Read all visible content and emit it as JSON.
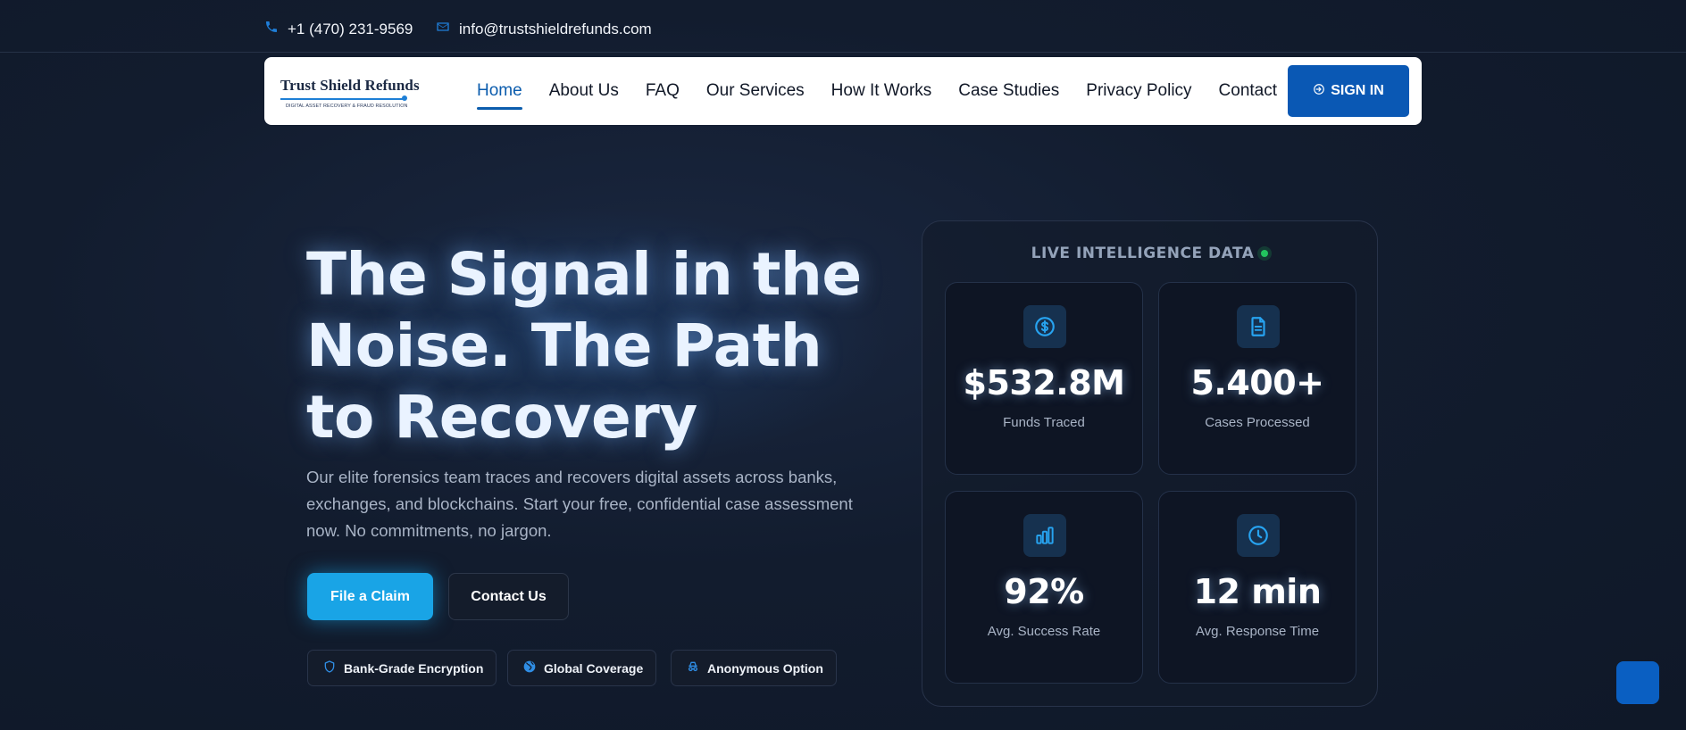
{
  "topbar": {
    "phone": "+1 (470) 231-9569",
    "email": "info@trustshieldrefunds.com",
    "phone_icon": "phone-icon",
    "email_icon": "mail-icon"
  },
  "nav": {
    "logo_title": "Trust Shield Refunds",
    "logo_subtitle": "DIGITAL ASSET RECOVERY & FRAUD RESOLUTION",
    "links": [
      "Home",
      "About Us",
      "FAQ",
      "Our Services",
      "How It Works",
      "Case Studies",
      "Privacy Policy",
      "Contact"
    ],
    "active": "Home",
    "signin_label": "SIGN IN",
    "signin_icon": "login-icon"
  },
  "hero": {
    "title": "The Signal in the Noise. The Path to Recovery",
    "description": "Our elite forensics team traces and recovers digital assets across banks, exchanges, and blockchains. Start your free, confidential case assessment now. No commitments, no jargon.",
    "primary_button": "File a Claim",
    "secondary_button": "Contact Us",
    "badges": [
      {
        "label": "Bank-Grade Encryption",
        "icon": "shield-icon"
      },
      {
        "label": "Global Coverage",
        "icon": "globe-icon"
      },
      {
        "label": "Anonymous Option",
        "icon": "incognito-icon"
      }
    ]
  },
  "stats_panel": {
    "header": "LIVE INTELLIGENCE DATA",
    "live_color": "#22c55e",
    "stats": [
      {
        "value": "$532.8M",
        "label": "Funds Traced",
        "icon": "dollar-icon"
      },
      {
        "value": "5.400+",
        "label": "Cases Processed",
        "icon": "document-icon"
      },
      {
        "value": "92%",
        "label": "Avg. Success Rate",
        "icon": "bar-chart-icon"
      },
      {
        "value": "12 min",
        "label": "Avg. Response Time",
        "icon": "clock-icon"
      }
    ]
  },
  "colors": {
    "background": "#111a2b",
    "accent": "#19a4e6",
    "brand_blue": "#0a58b4"
  }
}
